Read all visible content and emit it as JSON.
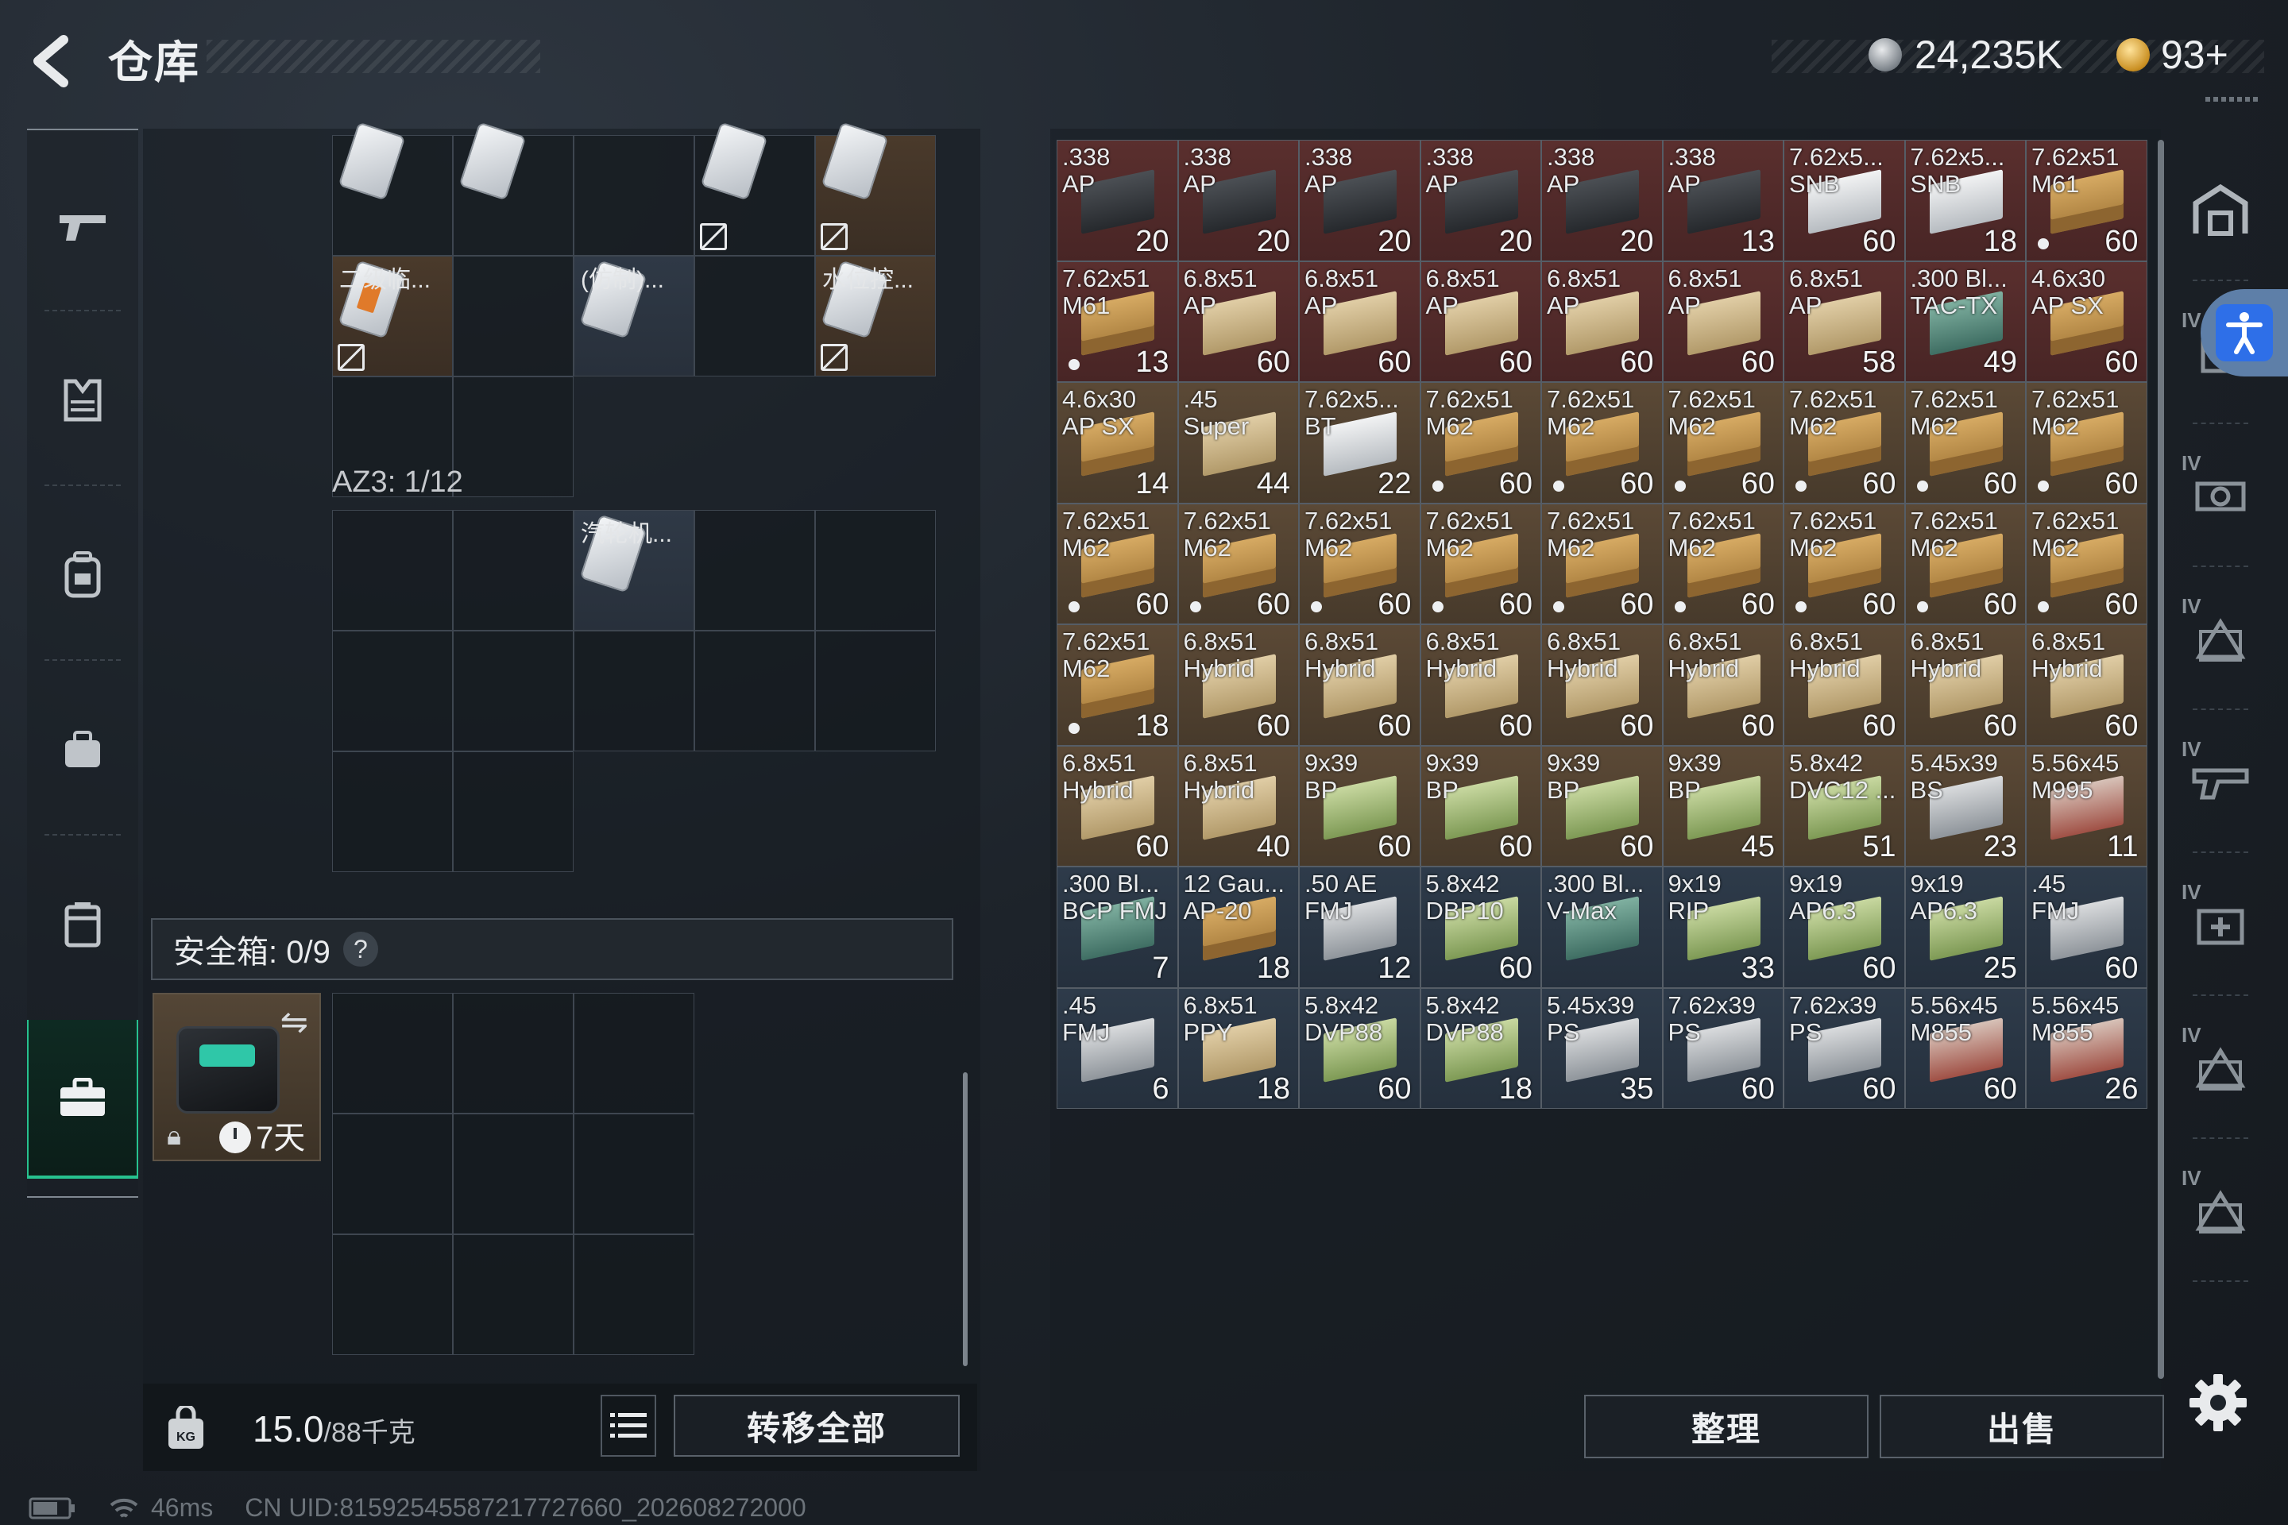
{
  "header": {
    "title": "仓库"
  },
  "currency": {
    "silver": "24,235K",
    "gold": "93+"
  },
  "left_rail": {
    "items": [
      "weapon",
      "armor",
      "backpack",
      "chest-rig",
      "container",
      "safe-case"
    ]
  },
  "containers": {
    "top_labels": [
      "二级临...",
      "(仿制)...",
      "水位控..."
    ],
    "az3_label": "AZ3: 1/12",
    "az3_item_label": "汽轮机...",
    "safe_label": "安全箱: 0/9",
    "safe_help": "?",
    "safe_time": "7天"
  },
  "weight": {
    "value": "15.0",
    "max": "/88千克"
  },
  "buttons": {
    "transfer_all": "转移全部",
    "sort": "整理",
    "sell": "出售"
  },
  "status": {
    "ping": "46ms",
    "uid": "CN UID:815925455872177276​60_202608272000"
  },
  "ammo": [
    {
      "name": ".338\nAP",
      "count": "20",
      "color": "red",
      "box": "dark",
      "dot": false
    },
    {
      "name": ".338\nAP",
      "count": "20",
      "color": "red",
      "box": "dark",
      "dot": false
    },
    {
      "name": ".338\nAP",
      "count": "20",
      "color": "red",
      "box": "dark",
      "dot": false
    },
    {
      "name": ".338\nAP",
      "count": "20",
      "color": "red",
      "box": "dark",
      "dot": false
    },
    {
      "name": ".338\nAP",
      "count": "20",
      "color": "red",
      "box": "dark",
      "dot": false
    },
    {
      "name": ".338\nAP",
      "count": "13",
      "color": "red",
      "box": "dark",
      "dot": false
    },
    {
      "name": "7.62x5...\nSNB",
      "count": "60",
      "color": "red",
      "box": "white",
      "dot": false
    },
    {
      "name": "7.62x5...\nSNB",
      "count": "18",
      "color": "red",
      "box": "white",
      "dot": false
    },
    {
      "name": "7.62x51\nM61",
      "count": "60",
      "color": "red",
      "box": "cardboard",
      "dot": true
    },
    {
      "name": "7.62x51\nM61",
      "count": "13",
      "color": "red",
      "box": "cardboard",
      "dot": true
    },
    {
      "name": "6.8x51\nAP",
      "count": "60",
      "color": "red",
      "box": "tan",
      "dot": false
    },
    {
      "name": "6.8x51\nAP",
      "count": "60",
      "color": "red",
      "box": "tan",
      "dot": false
    },
    {
      "name": "6.8x51\nAP",
      "count": "60",
      "color": "red",
      "box": "tan",
      "dot": false
    },
    {
      "name": "6.8x51\nAP",
      "count": "60",
      "color": "red",
      "box": "tan",
      "dot": false
    },
    {
      "name": "6.8x51\nAP",
      "count": "60",
      "color": "red",
      "box": "tan",
      "dot": false
    },
    {
      "name": "6.8x51\nAP",
      "count": "58",
      "color": "red",
      "box": "tan",
      "dot": false
    },
    {
      "name": ".300 Bl...\nTAC-TX",
      "count": "49",
      "color": "red",
      "box": "teal",
      "dot": false
    },
    {
      "name": "4.6x30\nAP SX",
      "count": "60",
      "color": "red",
      "box": "cardboard",
      "dot": false
    },
    {
      "name": "4.6x30\nAP SX",
      "count": "14",
      "color": "brown",
      "box": "cardboard",
      "dot": false
    },
    {
      "name": ".45\nSuper",
      "count": "44",
      "color": "brown",
      "box": "tan",
      "dot": false
    },
    {
      "name": "7.62x5...\nBT",
      "count": "22",
      "color": "brown",
      "box": "white",
      "dot": false
    },
    {
      "name": "7.62x51\nM62",
      "count": "60",
      "color": "brown",
      "box": "cardboard",
      "dot": true
    },
    {
      "name": "7.62x51\nM62",
      "count": "60",
      "color": "brown",
      "box": "cardboard",
      "dot": true
    },
    {
      "name": "7.62x51\nM62",
      "count": "60",
      "color": "brown",
      "box": "cardboard",
      "dot": true
    },
    {
      "name": "7.62x51\nM62",
      "count": "60",
      "color": "brown",
      "box": "cardboard",
      "dot": true
    },
    {
      "name": "7.62x51\nM62",
      "count": "60",
      "color": "brown",
      "box": "cardboard",
      "dot": true
    },
    {
      "name": "7.62x51\nM62",
      "count": "60",
      "color": "brown",
      "box": "cardboard",
      "dot": true
    },
    {
      "name": "7.62x51\nM62",
      "count": "60",
      "color": "brown",
      "box": "cardboard",
      "dot": true
    },
    {
      "name": "7.62x51\nM62",
      "count": "60",
      "color": "brown",
      "box": "cardboard",
      "dot": true
    },
    {
      "name": "7.62x51\nM62",
      "count": "60",
      "color": "brown",
      "box": "cardboard",
      "dot": true
    },
    {
      "name": "7.62x51\nM62",
      "count": "60",
      "color": "brown",
      "box": "cardboard",
      "dot": true
    },
    {
      "name": "7.62x51\nM62",
      "count": "60",
      "color": "brown",
      "box": "cardboard",
      "dot": true
    },
    {
      "name": "7.62x51\nM62",
      "count": "60",
      "color": "brown",
      "box": "cardboard",
      "dot": true
    },
    {
      "name": "7.62x51\nM62",
      "count": "60",
      "color": "brown",
      "box": "cardboard",
      "dot": true
    },
    {
      "name": "7.62x51\nM62",
      "count": "60",
      "color": "brown",
      "box": "cardboard",
      "dot": true
    },
    {
      "name": "7.62x51\nM62",
      "count": "60",
      "color": "brown",
      "box": "cardboard",
      "dot": true
    },
    {
      "name": "7.62x51\nM62",
      "count": "18",
      "color": "brown",
      "box": "cardboard",
      "dot": true
    },
    {
      "name": "6.8x51\nHybrid",
      "count": "60",
      "color": "brown",
      "box": "tan",
      "dot": false
    },
    {
      "name": "6.8x51\nHybrid",
      "count": "60",
      "color": "brown",
      "box": "tan",
      "dot": false
    },
    {
      "name": "6.8x51\nHybrid",
      "count": "60",
      "color": "brown",
      "box": "tan",
      "dot": false
    },
    {
      "name": "6.8x51\nHybrid",
      "count": "60",
      "color": "brown",
      "box": "tan",
      "dot": false
    },
    {
      "name": "6.8x51\nHybrid",
      "count": "60",
      "color": "brown",
      "box": "tan",
      "dot": false
    },
    {
      "name": "6.8x51\nHybrid",
      "count": "60",
      "color": "brown",
      "box": "tan",
      "dot": false
    },
    {
      "name": "6.8x51\nHybrid",
      "count": "60",
      "color": "brown",
      "box": "tan",
      "dot": false
    },
    {
      "name": "6.8x51\nHybrid",
      "count": "60",
      "color": "brown",
      "box": "tan",
      "dot": false
    },
    {
      "name": "6.8x51\nHybrid",
      "count": "60",
      "color": "brown",
      "box": "tan",
      "dot": false
    },
    {
      "name": "6.8x51\nHybrid",
      "count": "40",
      "color": "brown",
      "box": "tan",
      "dot": false
    },
    {
      "name": "9x39\nBP",
      "count": "60",
      "color": "brown",
      "box": "green",
      "dot": false
    },
    {
      "name": "9x39\nBP",
      "count": "60",
      "color": "brown",
      "box": "green",
      "dot": false
    },
    {
      "name": "9x39\nBP",
      "count": "60",
      "color": "brown",
      "box": "green",
      "dot": false
    },
    {
      "name": "9x39\nBP",
      "count": "45",
      "color": "brown",
      "box": "green",
      "dot": false
    },
    {
      "name": "5.8x42\nDVC12 ...",
      "count": "51",
      "color": "brown",
      "box": "green",
      "dot": false
    },
    {
      "name": "5.45x39\nBS",
      "count": "23",
      "color": "brown",
      "box": "grey",
      "dot": false
    },
    {
      "name": "5.56x45\nM995",
      "count": "11",
      "color": "brown",
      "box": "redb",
      "dot": false
    },
    {
      "name": ".300 Bl...\nBCP FMJ",
      "count": "7",
      "color": "blue",
      "box": "teal",
      "dot": false
    },
    {
      "name": "12 Gau...\nAP-20",
      "count": "18",
      "color": "blue",
      "box": "cardboard",
      "dot": false
    },
    {
      "name": ".50 AE\nFMJ",
      "count": "12",
      "color": "blue",
      "box": "grey",
      "dot": false
    },
    {
      "name": "5.8x42\nDBP10",
      "count": "60",
      "color": "blue",
      "box": "green",
      "dot": false
    },
    {
      "name": ".300 Bl...\nV-Max",
      "count": "",
      "color": "blue",
      "box": "teal",
      "dot": false
    },
    {
      "name": "9x19\nRIP",
      "count": "33",
      "color": "blue",
      "box": "green",
      "dot": false
    },
    {
      "name": "9x19\nAP6.3",
      "count": "60",
      "color": "blue",
      "box": "green",
      "dot": false
    },
    {
      "name": "9x19\nAP6.3",
      "count": "25",
      "color": "blue",
      "box": "green",
      "dot": false
    },
    {
      "name": ".45\nFMJ",
      "count": "60",
      "color": "blue",
      "box": "grey",
      "dot": false
    },
    {
      "name": ".45\nFMJ",
      "count": "6",
      "color": "blue",
      "box": "grey",
      "dot": false
    },
    {
      "name": "6.8x51\nPPY",
      "count": "18",
      "color": "blue",
      "box": "tan",
      "dot": false
    },
    {
      "name": "5.8x42\nDVP88",
      "count": "60",
      "color": "blue",
      "box": "green",
      "dot": false
    },
    {
      "name": "5.8x42\nDVP88",
      "count": "18",
      "color": "blue",
      "box": "green",
      "dot": false
    },
    {
      "name": "5.45x39\nPS",
      "count": "35",
      "color": "blue",
      "box": "grey",
      "dot": false
    },
    {
      "name": "7.62x39\nPS",
      "count": "60",
      "color": "blue",
      "box": "grey",
      "dot": false
    },
    {
      "name": "7.62x39\nPS",
      "count": "60",
      "color": "blue",
      "box": "grey",
      "dot": false
    },
    {
      "name": "5.56x45\nM855",
      "count": "60",
      "color": "blue",
      "box": "redb",
      "dot": false
    },
    {
      "name": "5.56x45\nM855",
      "count": "26",
      "color": "blue",
      "box": "redb",
      "dot": false
    }
  ],
  "right_rail": {
    "iv_label": "IV"
  },
  "colors": {
    "accent": "#27c18f",
    "rarity_red": "#5a2f2e",
    "rarity_brown": "#5b4936",
    "rarity_blue": "#2e3b4a",
    "access": "#2e6fe8"
  }
}
